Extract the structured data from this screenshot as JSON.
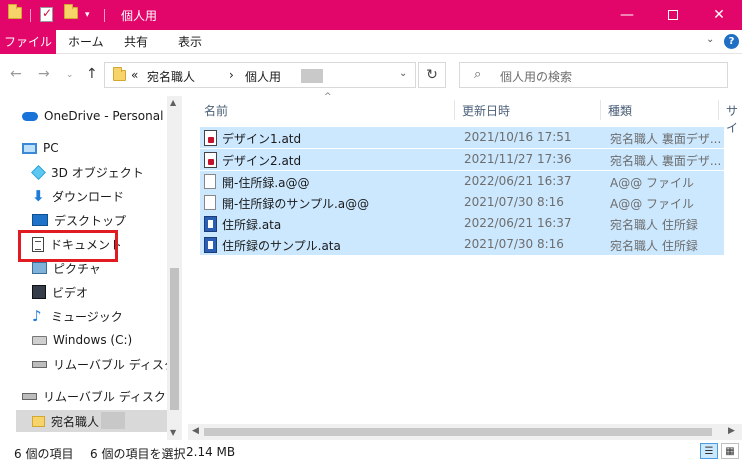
{
  "title": "個人用",
  "ribbon": {
    "tabs": [
      "ファイル",
      "ホーム",
      "共有",
      "表示"
    ]
  },
  "address": {
    "prefix": "«",
    "crumbs": [
      "宛名職人",
      "個人用"
    ],
    "separator": "›"
  },
  "search": {
    "placeholder": "個人用の検索"
  },
  "sidebar": {
    "items": [
      {
        "label": "OneDrive - Personal",
        "icon": "onedrive-icon"
      },
      {
        "label": "PC",
        "icon": "pc-icon"
      },
      {
        "label": "3D オブジェクト",
        "icon": "3d-objects-icon"
      },
      {
        "label": "ダウンロード",
        "icon": "download-icon"
      },
      {
        "label": "デスクトップ",
        "icon": "desktop-icon"
      },
      {
        "label": "ドキュメント",
        "icon": "documents-icon"
      },
      {
        "label": "ピクチャ",
        "icon": "pictures-icon"
      },
      {
        "label": "ビデオ",
        "icon": "videos-icon"
      },
      {
        "label": "ミュージック",
        "icon": "music-icon"
      },
      {
        "label": "Windows (C:)",
        "icon": "drive-icon"
      },
      {
        "label": "リムーバブル ディスク (D:)",
        "icon": "usb-drive-icon"
      },
      {
        "label": "リムーバブル ディスク (D:)",
        "icon": "usb-drive-icon"
      },
      {
        "label": "宛名職人",
        "icon": "folder-icon"
      }
    ]
  },
  "columns": {
    "name": "名前",
    "date": "更新日時",
    "type": "種類",
    "size": "サイ"
  },
  "files": [
    {
      "name": "デザイン1.atd",
      "date": "2021/10/16 17:51",
      "type": "宛名職人 裏面デザ...",
      "icon": "atd-file-icon"
    },
    {
      "name": "デザイン2.atd",
      "date": "2021/11/27 17:36",
      "type": "宛名職人 裏面デザ...",
      "icon": "atd-file-icon"
    },
    {
      "name": "開-住所録.a@@",
      "date": "2022/06/21 16:37",
      "type": "A@@ ファイル",
      "icon": "file-icon"
    },
    {
      "name": "開-住所録のサンプル.a@@",
      "date": "2021/07/30 8:16",
      "type": "A@@ ファイル",
      "icon": "file-icon"
    },
    {
      "name": "住所録.ata",
      "date": "2022/06/21 16:37",
      "type": "宛名職人 住所録",
      "icon": "ata-file-icon"
    },
    {
      "name": "住所録のサンプル.ata",
      "date": "2021/07/30 8:16",
      "type": "宛名職人 住所録",
      "icon": "ata-file-icon"
    }
  ],
  "status": {
    "count": "6 個の項目",
    "selected": "6 個の項目を選択",
    "size": "2.14 MB"
  },
  "colors": {
    "accent": "#e3066a",
    "selection": "#cce8ff",
    "highlight": "#e11b22"
  }
}
